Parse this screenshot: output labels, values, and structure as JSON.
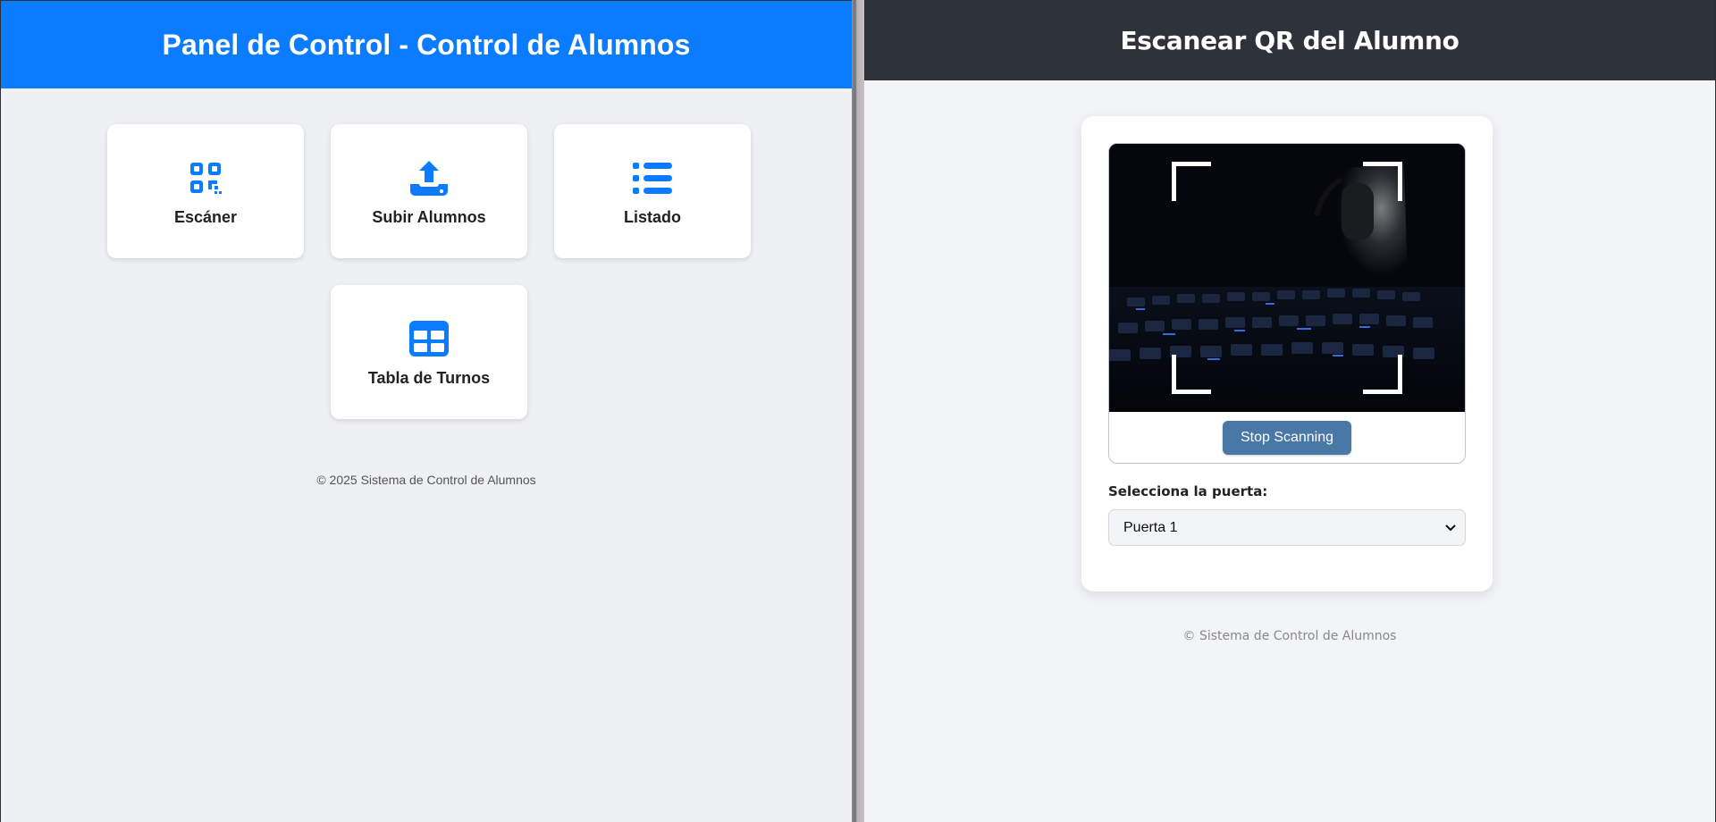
{
  "left": {
    "title": "Panel de Control - Control de Alumnos",
    "cards": [
      {
        "label": "Escáner",
        "icon": "qr-code-icon"
      },
      {
        "label": "Subir Alumnos",
        "icon": "upload-icon"
      },
      {
        "label": "Listado",
        "icon": "list-icon"
      },
      {
        "label": "Tabla de Turnos",
        "icon": "table-icon"
      }
    ],
    "footer": "© 2025 Sistema de Control de Alumnos",
    "accent": "#0b7cff"
  },
  "right": {
    "title": "Escanear QR del Alumno",
    "stop_label": "Stop Scanning",
    "gate_label": "Selecciona la puerta:",
    "gate_selected": "Puerta 1",
    "footer": "© Sistema de Control de Alumnos",
    "header_color": "#2e333b",
    "button_color": "#4a78a6"
  }
}
